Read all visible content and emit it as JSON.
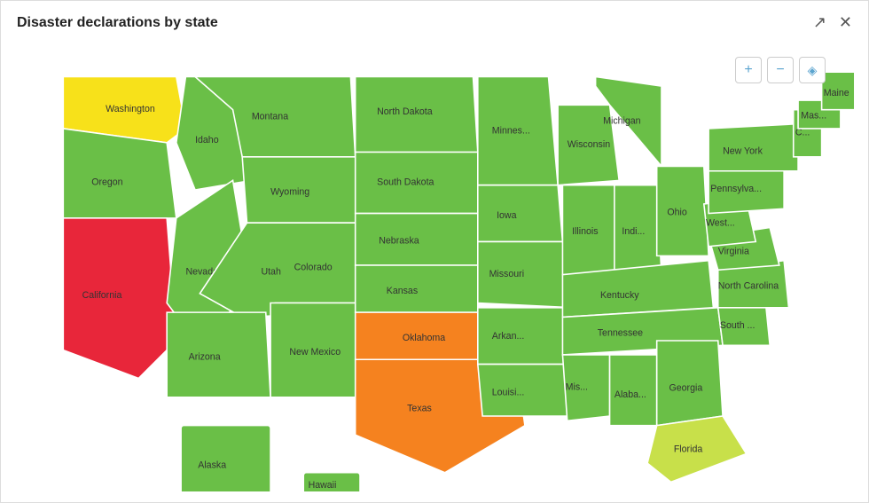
{
  "header": {
    "title": "Disaster declarations by state",
    "share_icon": "share-icon",
    "close_icon": "close-icon"
  },
  "map_controls": {
    "zoom_in": "+",
    "zoom_out": "−",
    "reset": "◎"
  },
  "states": [
    {
      "id": "WA",
      "label": "Washington",
      "color": "#f7e11a"
    },
    {
      "id": "OR",
      "label": "Oregon",
      "color": "#6abf47"
    },
    {
      "id": "CA",
      "label": "California",
      "color": "#e8263a"
    },
    {
      "id": "ID",
      "label": "Idaho",
      "color": "#6abf47"
    },
    {
      "id": "NV",
      "label": "Nevada",
      "color": "#6abf47"
    },
    {
      "id": "MT",
      "label": "Montana",
      "color": "#6abf47"
    },
    {
      "id": "WY",
      "label": "Wyoming",
      "color": "#6abf47"
    },
    {
      "id": "UT",
      "label": "Utah",
      "color": "#6abf47"
    },
    {
      "id": "CO",
      "label": "Colorado",
      "color": "#6abf47"
    },
    {
      "id": "NM",
      "label": "New Mexico",
      "color": "#6abf47"
    },
    {
      "id": "AZ",
      "label": "Arizona",
      "color": "#6abf47"
    },
    {
      "id": "ND",
      "label": "North Dakota",
      "color": "#6abf47"
    },
    {
      "id": "SD",
      "label": "South Dakota",
      "color": "#6abf47"
    },
    {
      "id": "NE",
      "label": "Nebraska",
      "color": "#6abf47"
    },
    {
      "id": "KS",
      "label": "Kansas",
      "color": "#6abf47"
    },
    {
      "id": "OK",
      "label": "Oklahoma",
      "color": "#f5821f"
    },
    {
      "id": "TX",
      "label": "Texas",
      "color": "#f5821f"
    },
    {
      "id": "MN",
      "label": "Minnes...",
      "color": "#6abf47"
    },
    {
      "id": "IA",
      "label": "Iowa",
      "color": "#6abf47"
    },
    {
      "id": "MO",
      "label": "Missouri",
      "color": "#6abf47"
    },
    {
      "id": "AR",
      "label": "Arkan...",
      "color": "#6abf47"
    },
    {
      "id": "LA",
      "label": "Louisi...",
      "color": "#6abf47"
    },
    {
      "id": "WI",
      "label": "Wisconsin",
      "color": "#6abf47"
    },
    {
      "id": "IL",
      "label": "Illinois",
      "color": "#6abf47"
    },
    {
      "id": "IN",
      "label": "Indi...",
      "color": "#6abf47"
    },
    {
      "id": "MI",
      "label": "Michigan",
      "color": "#6abf47"
    },
    {
      "id": "OH",
      "label": "Ohio",
      "color": "#6abf47"
    },
    {
      "id": "KY",
      "label": "Kentucky",
      "color": "#6abf47"
    },
    {
      "id": "TN",
      "label": "Tennessee",
      "color": "#6abf47"
    },
    {
      "id": "MS",
      "label": "Mis...",
      "color": "#6abf47"
    },
    {
      "id": "AL",
      "label": "Alaba...",
      "color": "#6abf47"
    },
    {
      "id": "GA",
      "label": "Georgia",
      "color": "#6abf47"
    },
    {
      "id": "FL",
      "label": "Florida",
      "color": "#c8e04a"
    },
    {
      "id": "SC",
      "label": "South ...",
      "color": "#6abf47"
    },
    {
      "id": "NC",
      "label": "North Carolina",
      "color": "#6abf47"
    },
    {
      "id": "VA",
      "label": "Virginia",
      "color": "#6abf47"
    },
    {
      "id": "WV",
      "label": "West...",
      "color": "#6abf47"
    },
    {
      "id": "PA",
      "label": "Pennsylva...",
      "color": "#6abf47"
    },
    {
      "id": "NY",
      "label": "New York",
      "color": "#6abf47"
    },
    {
      "id": "VT",
      "label": "C...",
      "color": "#6abf47"
    },
    {
      "id": "ME",
      "label": "Maine",
      "color": "#6abf47"
    },
    {
      "id": "NH",
      "label": "Mas...",
      "color": "#6abf47"
    },
    {
      "id": "AK",
      "label": "Alaska",
      "color": "#6abf47"
    },
    {
      "id": "HI",
      "label": "Hawaii",
      "color": "#6abf47"
    }
  ]
}
